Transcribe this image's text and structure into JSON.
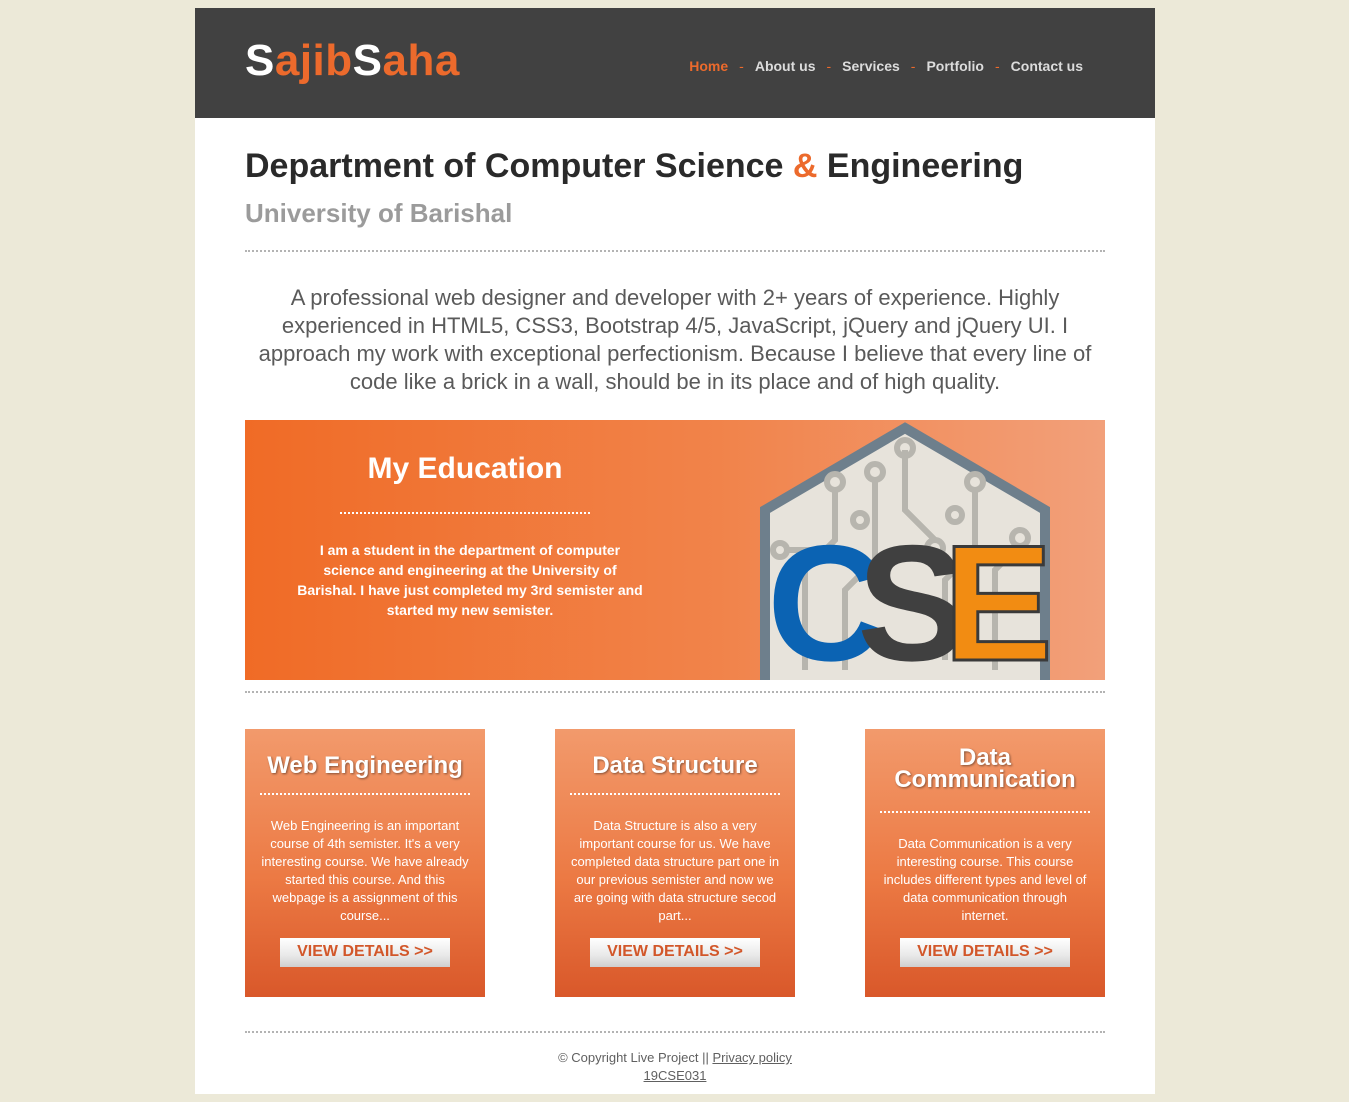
{
  "header": {
    "logo": {
      "s1": "S",
      "p1": "ajib",
      "s2": "S",
      "p2": "aha"
    },
    "nav": [
      {
        "label": "Home"
      },
      {
        "label": "About us"
      },
      {
        "label": "Services"
      },
      {
        "label": "Portfolio"
      },
      {
        "label": "Contact us"
      }
    ],
    "separator": "-"
  },
  "hero": {
    "title_part1": "Department of Computer Science ",
    "title_amp": "&",
    "title_part2": " Engineering",
    "subtitle": "University of Barishal",
    "intro": "A professional web designer and developer with 2+ years of experience. Highly experienced in HTML5, CSS3, Bootstrap 4/5, JavaScript, jQuery and jQuery UI. I approach my work with exceptional perfectionism. Because I believe that every line of code like a brick in a wall, should be in its place and of high quality."
  },
  "education": {
    "title": "My Education",
    "text": "I am a student in the department of computer science and engineering at the University of Barishal. I have just completed my 3rd semister and started my new semister.",
    "logo_letters": [
      "C",
      "S",
      "E"
    ]
  },
  "cards": [
    {
      "title": "Web Engineering",
      "text": "Web Engineering is an important course of 4th semister. It's a very interesting course. We have already started this course. And this webpage is a assignment of this course...",
      "button": "VIEW DETAILS >>"
    },
    {
      "title": "Data Structure",
      "text": "Data Structure is also a very important course for us. We have completed data structure part one in our previous semister and now we are going with data structure secod part...",
      "button": "VIEW DETAILS >>"
    },
    {
      "title_line1": "Data",
      "title_line2": "Communication",
      "text": "Data Communication is a very interesting course. This course includes different types and level of data communication through internet.",
      "button": "VIEW DETAILS >>"
    }
  ],
  "footer": {
    "copyright": "© Copyright Live Project || ",
    "privacy": "Privacy policy",
    "id": "19CSE031"
  },
  "colors": {
    "accent": "#ec6a2c",
    "header_bg": "#414141",
    "page_bg": "#ece9d8",
    "logo_blue": "#0b63b3",
    "logo_dark": "#404040",
    "logo_orange": "#f28c12"
  }
}
